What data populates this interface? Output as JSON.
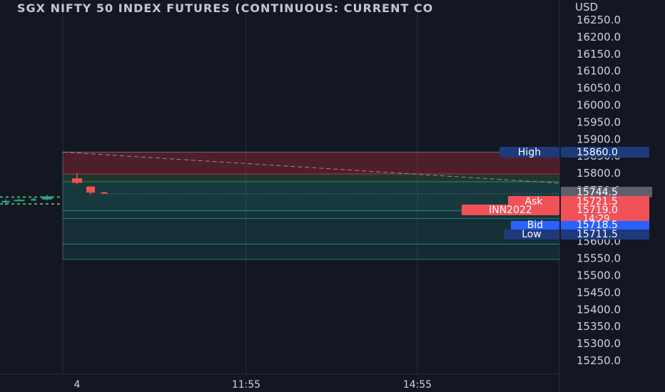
{
  "chart_data": {
    "type": "candlestick",
    "title": "SGX NIFTY 50 INDEX FUTURES (CONTINUOUS: CURRENT CO",
    "currency": "USD",
    "ylim": [
      15215,
      16270
    ],
    "y_ticks": [
      "16250.0",
      "16200.0",
      "16150.0",
      "16100.0",
      "16050.0",
      "16000.0",
      "15950.0",
      "15900.0",
      "15850.0",
      "15800.0",
      "15750.0",
      "15700.0",
      "15650.0",
      "15600.0",
      "15550.0",
      "15500.0",
      "15450.0",
      "15400.0",
      "15350.0",
      "15300.0",
      "15250.0"
    ],
    "x_ticks": [
      "4",
      "11:55",
      "14:55"
    ],
    "candles": [
      {
        "open": 15712,
        "high": 15722,
        "low": 15704,
        "close": 15717,
        "dir": "up"
      },
      {
        "open": 15718,
        "high": 15723,
        "low": 15715,
        "close": 15720,
        "dir": "up"
      },
      {
        "open": 15721,
        "high": 15726,
        "low": 15718,
        "close": 15722,
        "dir": "up"
      },
      {
        "open": 15721,
        "high": 15734,
        "low": 15719,
        "close": 15730,
        "dir": "up"
      },
      {
        "open": 15783,
        "high": 15799,
        "low": 15765,
        "close": 15770,
        "dir": "down"
      },
      {
        "open": 15759,
        "high": 15760,
        "low": 15736,
        "close": 15741,
        "dir": "down"
      },
      {
        "open": 15742,
        "high": 15744,
        "low": 15740,
        "close": 15741,
        "dir": "down"
      }
    ],
    "prev_levels": [
      15728,
      15708
    ],
    "zones": [
      {
        "from": 15860,
        "to": 15796,
        "color": "#f23645",
        "opacity": 0.26
      },
      {
        "from": 15796,
        "to": 15773,
        "color": "#4caf50",
        "opacity": 0.22
      },
      {
        "from": 15773,
        "to": 15688,
        "color": "#26a69a",
        "opacity": 0.24
      },
      {
        "from": 15688,
        "to": 15665,
        "color": "#26a69a",
        "opacity": 0.2
      },
      {
        "from": 15665,
        "to": 15590,
        "color": "#26a69a",
        "opacity": 0.17
      },
      {
        "from": 15590,
        "to": 15545,
        "color": "#26a69a",
        "opacity": 0.14
      }
    ],
    "last_price": "15744.5",
    "markers": {
      "high": {
        "name": "High",
        "value": "15860.0",
        "price": 15860,
        "color": "#1e3a7a"
      },
      "ask": {
        "name": "Ask",
        "value": "15721.5",
        "price": 15738,
        "color": "#f05258"
      },
      "contract": {
        "name": "INN2022",
        "value": "15719.0",
        "countdown": "14:29",
        "price": 15723,
        "color": "#f05258"
      },
      "bid": {
        "name": "Bid",
        "value": "15718.5",
        "price": 15700,
        "color": "#2962ff"
      },
      "low": {
        "name": "Low",
        "value": "15711.5",
        "price": 15686,
        "color": "#1e3a7a"
      }
    }
  }
}
